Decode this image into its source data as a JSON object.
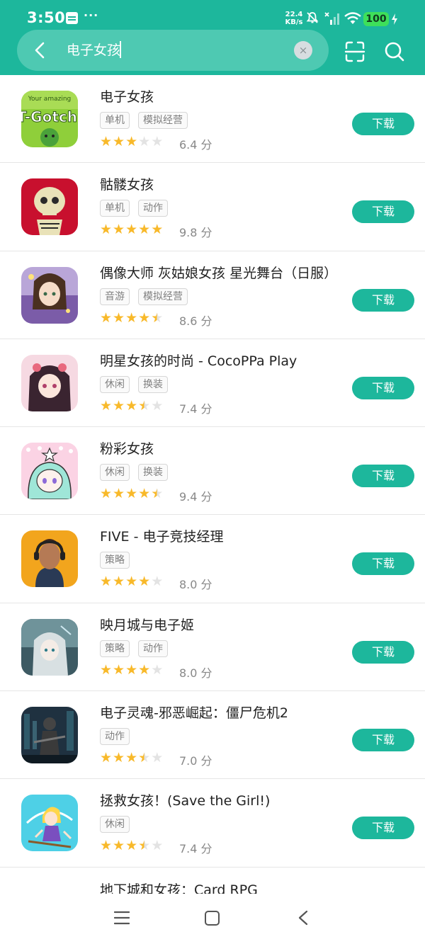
{
  "status_bar": {
    "time": "3:50",
    "dots": "···",
    "speed": "22.4",
    "speed_unit": "KB/s",
    "battery": "100"
  },
  "search": {
    "query": "电子女孩",
    "clear_glyph": "×"
  },
  "download_label": "下载",
  "score_unit": "分",
  "apps": [
    {
      "title": "电子女孩",
      "tags": [
        "单机",
        "模拟经营"
      ],
      "rating": 3.0,
      "score": "6.4"
    },
    {
      "title": "骷髅女孩",
      "tags": [
        "单机",
        "动作"
      ],
      "rating": 5.0,
      "score": "9.8"
    },
    {
      "title": "偶像大师 灰姑娘女孩 星光舞台（日服）",
      "tags": [
        "音游",
        "模拟经营"
      ],
      "rating": 4.5,
      "score": "8.6"
    },
    {
      "title": "明星女孩的时尚 - CocoPPa Play",
      "tags": [
        "休闲",
        "换装"
      ],
      "rating": 3.5,
      "score": "7.4"
    },
    {
      "title": "粉彩女孩",
      "tags": [
        "休闲",
        "换装"
      ],
      "rating": 4.5,
      "score": "9.4"
    },
    {
      "title": "FIVE - 电子竞技经理",
      "tags": [
        "策略"
      ],
      "rating": 4.0,
      "score": "8.0"
    },
    {
      "title": "映月城与电子姬",
      "tags": [
        "策略",
        "动作"
      ],
      "rating": 4.0,
      "score": "8.0"
    },
    {
      "title": "电子灵魂-邪恶崛起：僵尸危机2",
      "tags": [
        "动作"
      ],
      "rating": 3.5,
      "score": "7.0"
    },
    {
      "title": "拯救女孩！(Save the Girl!)",
      "tags": [
        "休闲"
      ],
      "rating": 3.5,
      "score": "7.4"
    }
  ],
  "partial_app": {
    "title": "地下城和女孩：Card RPG"
  },
  "icons": {
    "back": "chevron-left-icon",
    "scan": "scan-icon",
    "search": "search-icon",
    "nav_menu": "menu-icon",
    "nav_home": "home-icon",
    "nav_back": "back-icon"
  },
  "colors": {
    "accent": "#1db79c",
    "star": "#f8b92a",
    "star_empty": "#e3e3e3"
  }
}
